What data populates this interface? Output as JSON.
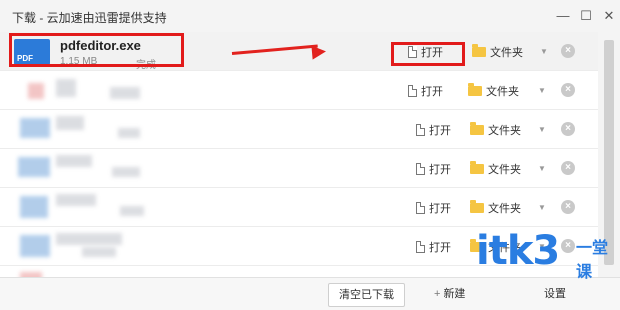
{
  "window": {
    "title": "下载 - 云加速由迅雷提供支持",
    "min_icon": "minimize-icon",
    "max_icon": "maximize-icon",
    "close_icon": "close-icon",
    "min_glyph": "—",
    "max_glyph": "☐",
    "close_glyph": "✕"
  },
  "downloads": [
    {
      "name": "pdfeditor.exe",
      "size": "1.15 MB",
      "status": "完成",
      "icon_text": "PDF",
      "open_label": "打开",
      "folder_label": "文件夹"
    },
    {
      "name": "",
      "size": "",
      "status": "",
      "open_label": "打开",
      "folder_label": "文件夹"
    },
    {
      "name": "",
      "size": "",
      "status": "",
      "open_label": "打开",
      "folder_label": "文件夹"
    },
    {
      "name": "",
      "size": "",
      "status": "",
      "open_label": "打开",
      "folder_label": "文件夹"
    },
    {
      "name": "",
      "size": "",
      "status": "",
      "open_label": "打开",
      "folder_label": "文件夹"
    },
    {
      "name": "",
      "size": "",
      "status": "",
      "open_label": "打开",
      "folder_label": "文件夹"
    }
  ],
  "footer": {
    "clear_label": "清空已下载",
    "new_label": "新建",
    "settings_label": "设置"
  },
  "watermark": {
    "main": "itk3",
    "sub": "一堂课"
  },
  "colors": {
    "annotation_red": "#e21b1b",
    "accent_blue": "#2a7de1",
    "folder_yellow": "#f5c542"
  }
}
